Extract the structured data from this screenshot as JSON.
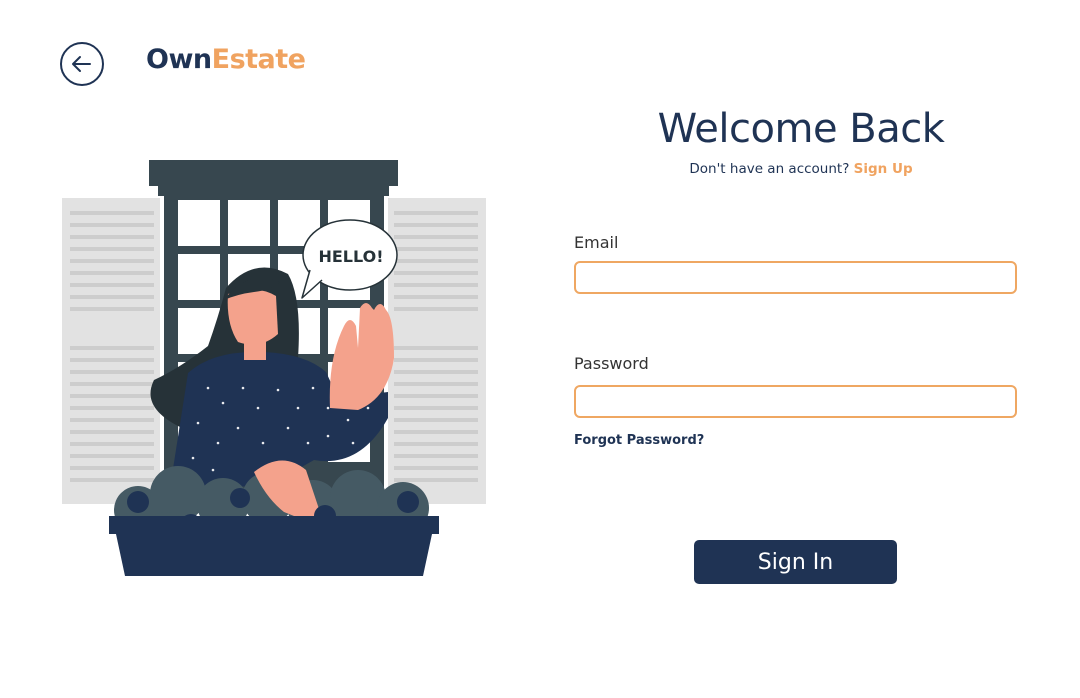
{
  "brand": {
    "part1": "Own",
    "part2": "Estate"
  },
  "illustration": {
    "speech_text": "HELLO!"
  },
  "form": {
    "title": "Welcome Back",
    "subtitle_prefix": "Don't have an account?",
    "signup_link": "Sign Up",
    "email_label": "Email",
    "email_value": "",
    "password_label": "Password",
    "password_value": "",
    "forgot_link": "Forgot Password?",
    "submit_label": "Sign In"
  },
  "icons": {
    "back": "arrow-left-icon"
  },
  "colors": {
    "primary": "#1f3354",
    "accent": "#f0a360",
    "field_border": "#efa762"
  }
}
